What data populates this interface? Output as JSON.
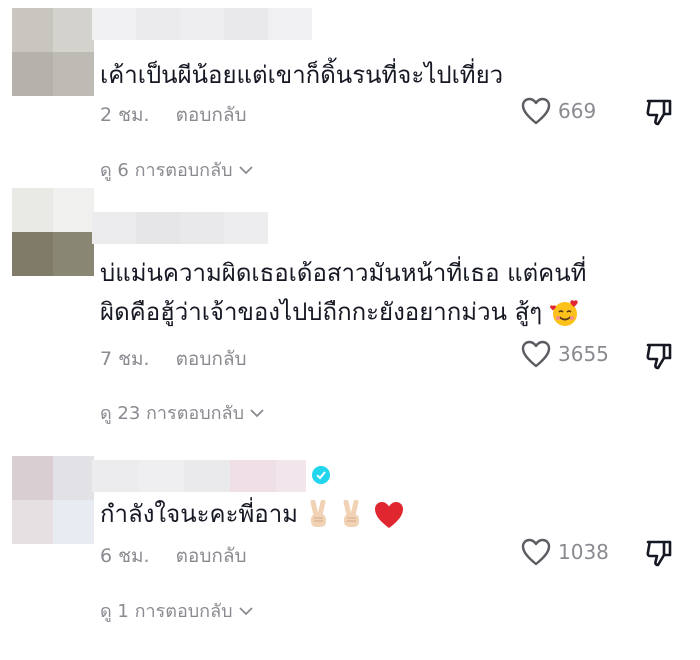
{
  "comments": [
    {
      "text": "เค้าเป็นผีน้อยแต่เขาก็ดิ้นรนที่จะไปเที่ยว",
      "time": "2 ชม.",
      "reply_label": "ตอบกลับ",
      "likes": "669",
      "view_replies": "ดู 6 การตอบกลับ"
    },
    {
      "text_line1": "บ่แม่นความผิดเธอเด้อสาวมันหน้าที่เธอ แต่คนที่",
      "text_line2": "ผิดคือฮู้ว่าเจ้าของไปบ่ถืกกะยังอยากม่วน สู้ๆ",
      "time": "7 ชม.",
      "reply_label": "ตอบกลับ",
      "likes": "3655",
      "view_replies": "ดู 23 การตอบกลับ"
    },
    {
      "text": "กำลังใจนะคะพี่อาม",
      "time": "6 ชม.",
      "reply_label": "ตอบกลับ",
      "likes": "1038",
      "view_replies": "ดู 1 การตอบกลับ"
    }
  ],
  "colors": {
    "text": "#161823",
    "secondary": "#8a8b91",
    "verified": "#20d5ec",
    "heart_emoji": "#e0262e"
  },
  "icons": [
    "heart-outline-icon",
    "thumbs-down-icon",
    "chevron-down-icon",
    "verified-badge-icon",
    "victory-hand-emoji",
    "red-heart-emoji",
    "smiling-face-with-hearts-emoji"
  ]
}
